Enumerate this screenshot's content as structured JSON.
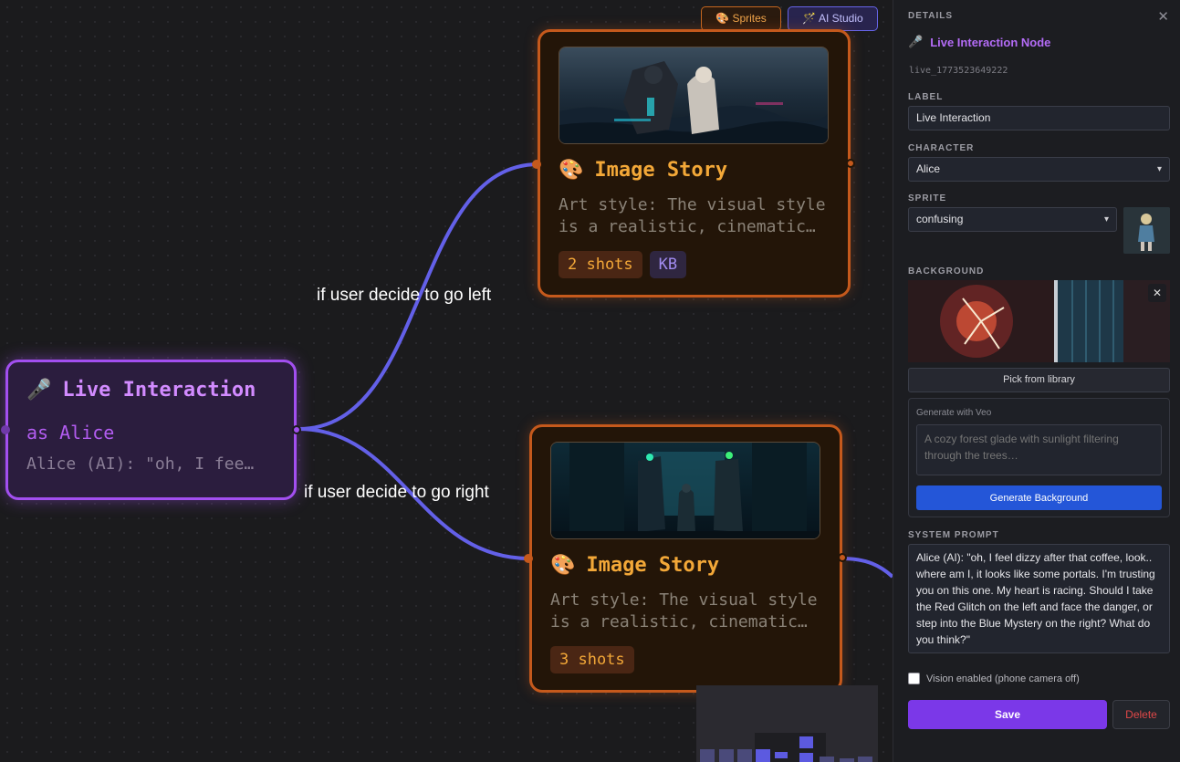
{
  "toolbar": {
    "sprites_label": "🎨 Sprites",
    "ai_studio_label": "🪄 AI Studio"
  },
  "edges": {
    "left_label": "if user decide to go left",
    "right_label": "if user decide to go right",
    "color": "#6360e8"
  },
  "live_node": {
    "icon": "🎤",
    "title": "Live Interaction",
    "character_line": "as Alice",
    "prompt_preview": "Alice (AI): \"oh, I fee…",
    "accent": "#a24ff0"
  },
  "story_nodes": [
    {
      "icon": "🎨",
      "title": "Image Story",
      "desc_line1": "Art style: The visual style",
      "desc_line2": "is a realistic, cinematic…",
      "shots": "2 shots",
      "kb": "KB"
    },
    {
      "icon": "🎨",
      "title": "Image Story",
      "desc_line1": "Art style: The visual style",
      "desc_line2": "is a realistic, cinematic…",
      "shots": "3 shots"
    }
  ],
  "details": {
    "heading": "DETAILS",
    "close_icon": "✕",
    "node_icon": "🎤",
    "node_type": "Live Interaction Node",
    "node_id": "live_1773523649222",
    "label_heading": "LABEL",
    "label_value": "Live Interaction",
    "character_heading": "CHARACTER",
    "character_value": "Alice",
    "sprite_heading": "SPRITE",
    "sprite_value": "confusing",
    "background_heading": "BACKGROUND",
    "pick_library": "Pick from library",
    "veo_label": "Generate with Veo",
    "veo_placeholder": "A cozy forest glade with sunlight filtering through the trees…",
    "veo_button": "Generate Background",
    "system_prompt_heading": "SYSTEM PROMPT",
    "system_prompt": "Alice (AI): \"oh, I feel dizzy after that coffee, look.. where am I, it looks like some portals. I'm trusting you on this one. My heart is racing. Should I take the Red Glitch on the left and face the danger, or step into the Blue Mystery on the right? What do you think?\"",
    "vision_label": "Vision enabled (phone camera off)",
    "vision_checked": false,
    "save": "Save",
    "delete": "Delete"
  },
  "colors": {
    "live_accent": "#a24ff0",
    "story_accent": "#c5591c",
    "story_title": "#f3a838",
    "save_button": "#7b38e8",
    "generate_button": "#2456d8",
    "delete_text": "#e04848"
  }
}
